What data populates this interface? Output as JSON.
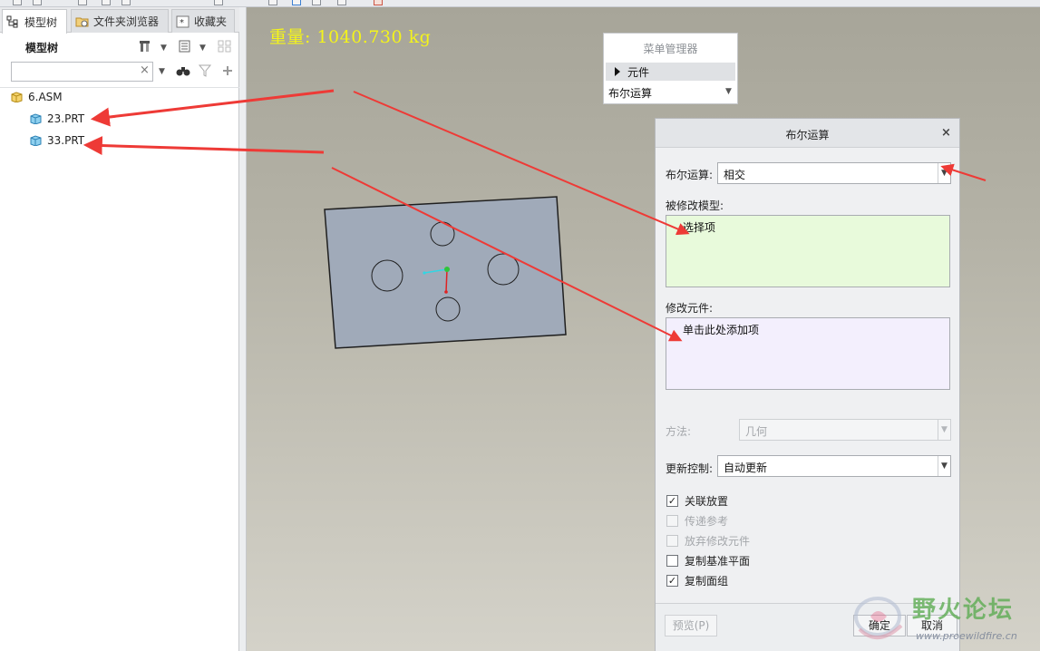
{
  "left_panel": {
    "tabs": [
      {
        "label": "模型树",
        "icon": "model-tree-icon"
      },
      {
        "label": "文件夹浏览器",
        "icon": "folder-browser-icon"
      },
      {
        "label": "收藏夹",
        "icon": "favorites-icon"
      }
    ],
    "tree_title": "模型树",
    "filter": {
      "value": "",
      "placeholder": ""
    },
    "tree": [
      {
        "label": "6.ASM",
        "type": "assembly"
      },
      {
        "label": "23.PRT",
        "type": "part"
      },
      {
        "label": "33.PRT",
        "type": "part"
      }
    ]
  },
  "viewport": {
    "mass_readout": "重量: 1040.730 kg",
    "mass_color": "#f4f41a"
  },
  "menu_manager": {
    "title": "菜单管理器",
    "item": "元件",
    "submenu": "布尔运算"
  },
  "boolean_dialog": {
    "title": "布尔运算",
    "operation_label": "布尔运算:",
    "operation_value": "相交",
    "modified_model_label": "被修改模型:",
    "modified_model_items": [
      "选择项"
    ],
    "modifying_components_label": "修改元件:",
    "modifying_components_placeholder": "单击此处添加项",
    "method_label": "方法:",
    "method_value": "几何",
    "update_control_label": "更新控制:",
    "update_control_value": "自动更新",
    "options": [
      {
        "label": "关联放置",
        "checked": true,
        "enabled": true
      },
      {
        "label": "传递参考",
        "checked": false,
        "enabled": false
      },
      {
        "label": "放弃修改元件",
        "checked": false,
        "enabled": false
      },
      {
        "label": "复制基准平面",
        "checked": false,
        "enabled": true
      },
      {
        "label": "复制面组",
        "checked": true,
        "enabled": true
      }
    ],
    "buttons": {
      "preview": "预览(P)",
      "ok": "确定",
      "cancel": "取消"
    }
  },
  "annotation_color": "#ee3a36",
  "watermark": {
    "text": "野火论坛",
    "url": "www.proewildfire.cn"
  }
}
